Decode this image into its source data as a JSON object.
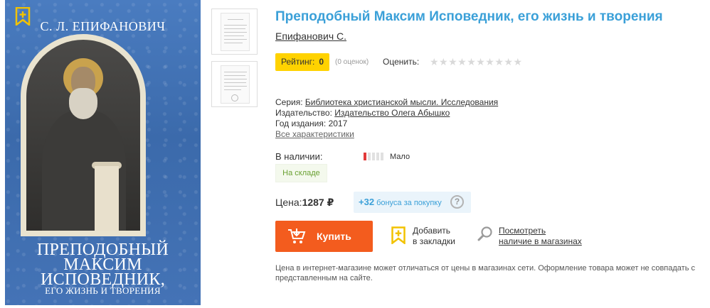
{
  "cover": {
    "author": "С. Л. ЕПИФАНОВИЧ",
    "title_lines": [
      "ПРЕПОДОБНЫЙ",
      "МАКСИМ",
      "ИСПОВЕДНИК,"
    ],
    "subtitle": "ЕГО ЖИЗНЬ И ТВОРЕНИЯ"
  },
  "product": {
    "title": "Преподобный Максим Исповедник, его жизнь и творения",
    "author": "Епифанович С."
  },
  "rating": {
    "label": "Рейтинг:",
    "value": "0",
    "count": "(0 оценок)",
    "rate_label": "Оценить:",
    "stars": "★★★★★★★★★★"
  },
  "characteristics": {
    "series_label": "Серия:",
    "series_value": "Библиотека христианской мысли. Исследования",
    "publisher_label": "Издательство:",
    "publisher_value": "Издательство Олега Абышко",
    "year_label": "Год издания:",
    "year_value": "2017",
    "all_link": "Все характеристики"
  },
  "stock": {
    "label": "В наличии:",
    "level_text": "Мало",
    "level": 0.2,
    "warehouse": "На складе"
  },
  "price": {
    "label": "Цена:",
    "value": "1287 ₽",
    "bonus_value": "+32",
    "bonus_text": "бонуса за покупку",
    "help": "?"
  },
  "actions": {
    "buy": "Купить",
    "bookmark_line1": "Добавить",
    "bookmark_line2": "в закладки",
    "stores_line1": "Посмотреть",
    "stores_line2": "наличие в магазинах"
  },
  "disclaimer": "Цена в интернет-магазине может отличаться от цены в магазинах сети. Оформление товара может не совпадать с представленным на сайте.",
  "colors": {
    "accent": "#3ba0d8",
    "buy": "#f35c1e",
    "rating": "#ffd200",
    "stock_low": "#e23a3a",
    "in_stock": "#6aa132"
  }
}
